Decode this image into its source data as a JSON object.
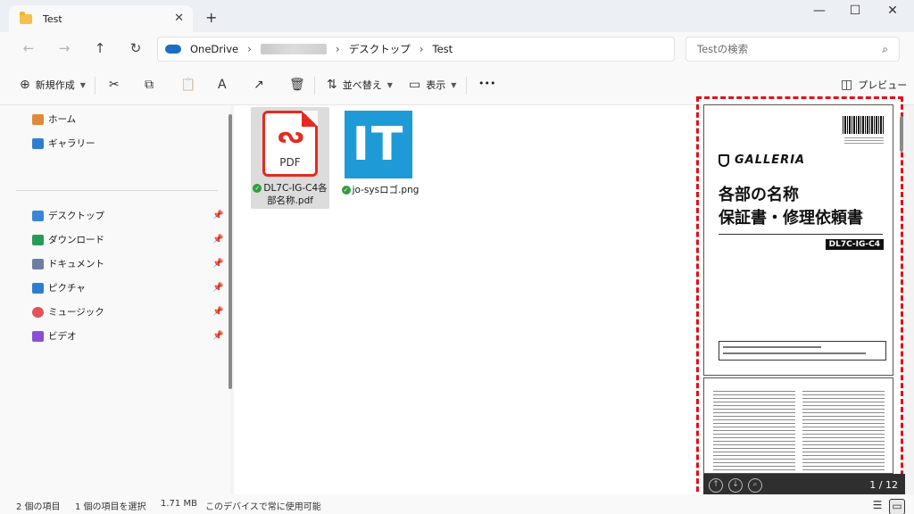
{
  "window": {
    "tab_title": "Test",
    "tab_close": "✕",
    "new_tab": "+",
    "minimize": "—",
    "maximize": "☐",
    "close": "✕"
  },
  "nav": {
    "back": "←",
    "forward": "→",
    "up": "↑",
    "refresh": "↻"
  },
  "address": {
    "root": "OneDrive",
    "crumbs": [
      "デスクトップ",
      "Test"
    ],
    "chevron": "›"
  },
  "search": {
    "placeholder": "Testの検索",
    "icon": "⌕"
  },
  "toolbar": {
    "new": "新規作成",
    "sort": "並べ替え",
    "view": "表示",
    "more": "•••",
    "preview": "プレビュー",
    "icons": {
      "new": "⊕",
      "cut": "✂",
      "copy": "⧉",
      "paste": "📋",
      "rename": "A",
      "share": "↗",
      "delete": "🗑",
      "sort": "⇅",
      "view": "▭",
      "preview": "◫"
    }
  },
  "sidebar": {
    "top": [
      {
        "label": "ホーム",
        "color": "#e3873a"
      },
      {
        "label": "ギャラリー",
        "color": "#2f7dd1"
      }
    ],
    "pinned": [
      {
        "label": "デスクトップ",
        "color": "#3a86d6"
      },
      {
        "label": "ダウンロード",
        "color": "#2a9a57"
      },
      {
        "label": "ドキュメント",
        "color": "#6b7fa5"
      },
      {
        "label": "ピクチャ",
        "color": "#2f7dd1"
      },
      {
        "label": "ミュージック",
        "color": "#e0535b"
      },
      {
        "label": "ビデオ",
        "color": "#8a4fd6"
      }
    ],
    "pin_glyph": "📌"
  },
  "files": [
    {
      "name": "DL7C-IG-C4各部名称.pdf",
      "icon_text": "PDF",
      "selected": true
    },
    {
      "name": "jo-sysロゴ.png",
      "icon_text": "IT",
      "selected": false
    }
  ],
  "sync_glyph": "✓",
  "preview": {
    "brand": "GALLERIA",
    "title_line1": "各部の名称",
    "title_line2": "保証書・修理依頼書",
    "model": "DL7C-IG-C4",
    "page_indicator": "1 / 12",
    "btn_up": "↑",
    "btn_down": "↓",
    "btn_search": "⌕"
  },
  "status": {
    "count": "2 個の項目",
    "selected": "1 個の項目を選択",
    "size": "1.71 MB",
    "availability": "このデバイスで常に使用可能"
  }
}
